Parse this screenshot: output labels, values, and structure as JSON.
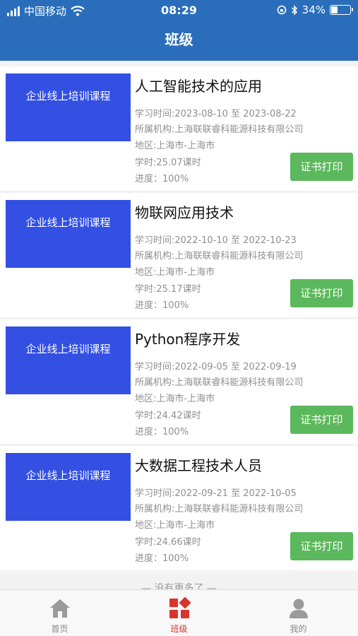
{
  "status_bar": {
    "carrier": "中国移动",
    "time": "08:29",
    "battery_percent": "34%",
    "battery_level": 0.34
  },
  "nav": {
    "title": "班级"
  },
  "courses": [
    {
      "thumb_label": "企业线上培训课程",
      "title": "人工智能技术的应用",
      "study_time": "学习时间:2023-08-10 至 2023-08-22",
      "organization": "所属机构:上海联联睿科能源科技有限公司",
      "region": "地区:上海市-上海市",
      "hours": "学时:25.07课时",
      "progress": "进度：100%",
      "button": "证书打印"
    },
    {
      "thumb_label": "企业线上培训课程",
      "title": "物联网应用技术",
      "study_time": "学习时间:2022-10-10 至 2022-10-23",
      "organization": "所属机构:上海联联睿科能源科技有限公司",
      "region": "地区:上海市-上海市",
      "hours": "学时:25.17课时",
      "progress": "进度：100%",
      "button": "证书打印"
    },
    {
      "thumb_label": "企业线上培训课程",
      "title": "Python程序开发",
      "study_time": "学习时间:2022-09-05 至 2022-09-19",
      "organization": "所属机构:上海联联睿科能源科技有限公司",
      "region": "地区:上海市-上海市",
      "hours": "学时:24.42课时",
      "progress": "进度：100%",
      "button": "证书打印"
    },
    {
      "thumb_label": "企业线上培训课程",
      "title": "大数据工程技术人员",
      "study_time": "学习时间:2022-09-21 至 2022-10-05",
      "organization": "所属机构:上海联联睿科能源科技有限公司",
      "region": "地区:上海市-上海市",
      "hours": "学时:24.66课时",
      "progress": "进度：100%",
      "button": "证书打印"
    }
  ],
  "more_tip": "— 没有更多了 —",
  "tabs": [
    {
      "label": "首页",
      "icon": "home-icon",
      "active": false
    },
    {
      "label": "班级",
      "icon": "class-icon",
      "active": true
    },
    {
      "label": "我的",
      "icon": "profile-icon",
      "active": false
    }
  ],
  "colors": {
    "header": "#2a6ebb",
    "thumb": "#3350e3",
    "button": "#5cb85c",
    "active_tab": "#d9342b",
    "inactive_tab": "#9b9b9b"
  }
}
